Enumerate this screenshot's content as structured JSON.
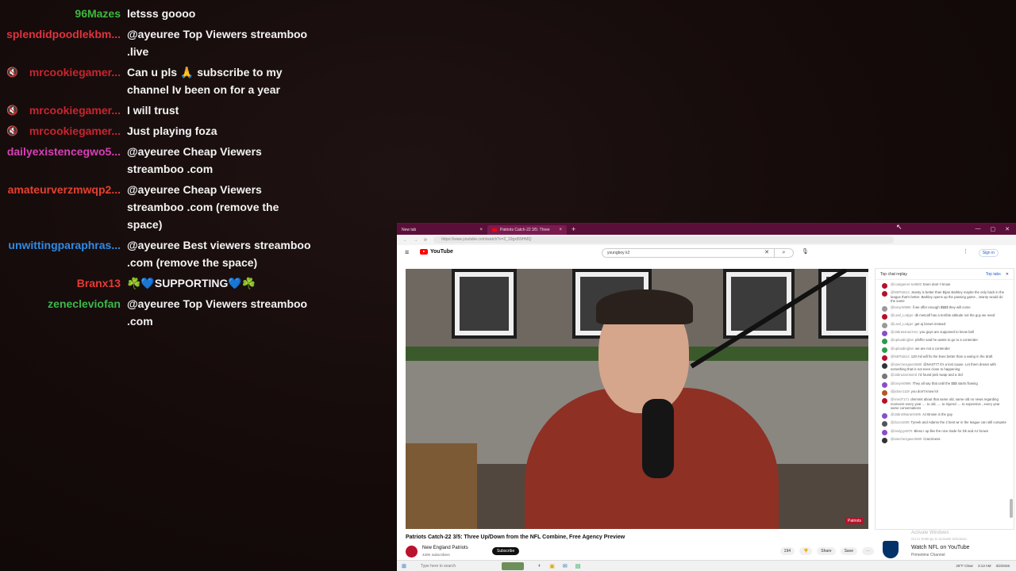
{
  "chat_overlay": [
    {
      "user": "96Mazes",
      "color": "#3db93d",
      "muted": false,
      "text": "letsss goooo"
    },
    {
      "user": "splendidpoodlekbm...",
      "color": "#e0333d",
      "muted": false,
      "text": "@ayeuree Top Viewers streamboo .live"
    },
    {
      "user": "mrcookiegamer...",
      "color": "#c8252f",
      "muted": true,
      "text": "Can u pls 🙏 subscribe to my channel Iv been on for a year"
    },
    {
      "user": "mrcookiegamer...",
      "color": "#c8252f",
      "muted": true,
      "text": "I will trust"
    },
    {
      "user": "mrcookiegamer...",
      "color": "#c8252f",
      "muted": true,
      "text": "Just playing foza"
    },
    {
      "user": "dailyexistencegwo5...",
      "color": "#d83fb6",
      "muted": false,
      "text": "@ayeuree Cheap Viewers streamboo .com"
    },
    {
      "user": "amateurverzmwqp2...",
      "color": "#e5402e",
      "muted": false,
      "text": "@ayeuree Cheap Viewers streamboo .com (remove the space)"
    },
    {
      "user": "unwittingparaphras...",
      "color": "#2f8be3",
      "muted": false,
      "text": "@ayeuree Best viewers streamboo .com (remove the space)"
    },
    {
      "user": "Branx13",
      "color": "#e53a36",
      "muted": false,
      "text": "☘️💙SUPPORTING💙☘️"
    },
    {
      "user": "zenecleviofan",
      "color": "#3cb84a",
      "muted": false,
      "text": "@ayeuree Top Viewers streamboo .com"
    }
  ],
  "mute_glyph": "🔇",
  "browser": {
    "tabs": [
      {
        "label": "New tab",
        "close": "×"
      },
      {
        "label": "Patriots Catch-22 3/5: Three",
        "close": "×"
      }
    ],
    "new_tab_glyph": "+",
    "window_controls": [
      "—",
      "▢",
      "✕"
    ],
    "url": "https://www.youtube.com/watch?v=2_19gxt59HMQ",
    "nav": {
      "back": "←",
      "forward": "→",
      "reload": "⟳"
    }
  },
  "youtube": {
    "logo_text": "YouTube",
    "menu_glyph": "≡",
    "search_value": "youngboy k2",
    "search_clear": "✕",
    "search_glyph": "⌕",
    "mic_glyph": "🎙",
    "more_glyph": "⋮",
    "signin_label": "Sign in",
    "video_title": "Patriots Catch-22 3/5: Three Up/Down from the NFL Combine, Free Agency Preview",
    "channel_name": "New England Patriots",
    "subscribers": "420K subscribers",
    "subscribe_label": "Subscribe",
    "likes": "194",
    "share_label": "Share",
    "save_label": "Save",
    "dislike_glyph": "👎",
    "overflow_glyph": "⋯",
    "watermark": "Patriots"
  },
  "live_chat": {
    "header": "Top chat replay",
    "top_selector": "Top tabs",
    "close_glyph": "✕",
    "messages": [
      {
        "author": "@coolgamer-tu9883",
        "text": "Even dont !! know",
        "color": "#b3122c"
      },
      {
        "author": "@NEPats14",
        "text": "Jeanty is better than Bijan Barkley maybe the only back in the league that's better. Barkley opens up the passing game , Jeanty would do the same",
        "color": "#b3122c"
      },
      {
        "author": "@tonym0996",
        "text": "if we offer enough $$$$ they will come",
        "color": "#999999"
      },
      {
        "author": "@Leaf_Lodger",
        "text": "dk metcalf has a terrible attitude not the guy we need",
        "color": "#b3122c"
      },
      {
        "author": "@Leaf_Lodger",
        "text": "get aj brown instead",
        "color": "#999999"
      },
      {
        "author": "@Jabrassnazzmo",
        "text": "you guys are supposed to know ball",
        "color": "#8a4fc7"
      },
      {
        "author": "@uploadingfan",
        "text": "pfeffer said he wants to go to a contender",
        "color": "#2e9b4b"
      },
      {
        "author": "@uploadingfan",
        "text": "we are not a contender",
        "color": "#2e9b4b"
      },
      {
        "author": "@NEPats14",
        "text": "120 mil will fix the lines better than a swing in the draft",
        "color": "#b3122c"
      },
      {
        "author": "@sanchezgave3680",
        "text": "@NA0777 it's a lost cause. Let them dream with something that is not even close to happening",
        "color": "#333333"
      },
      {
        "author": "@JabraJarrasmd",
        "text": "I'd found pick swap and a 3rd",
        "color": "#777777"
      },
      {
        "author": "@tonym0996",
        "text": "They all say that until the $$$ starts flowing",
        "color": "#8a4fc7"
      },
      {
        "author": "@jidour1118",
        "text": "you don't know lol",
        "color": "#b35a1f"
      },
      {
        "author": "@snnd7171",
        "text": "dmmmit about that same old, same old no news regarding receivers every year .... to old, .... to Injured .... to expensive , every year same conversations",
        "color": "#b3122c"
      },
      {
        "author": "@Jabro0baranh496",
        "text": "AJ Brown is the guy",
        "color": "#8a4fc7"
      },
      {
        "author": "@Zuzo1609",
        "text": "Tyreek and Adams the 2 best wr in the league can still compete",
        "color": "#555555"
      },
      {
        "author": "@realyyy4876",
        "text": "Bless I up like the nice trade for Dk and AJ brown",
        "color": "#8a4fc7"
      },
      {
        "author": "@sanchezgave3680",
        "text": "Crazziness",
        "color": "#333333"
      }
    ],
    "activate_title": "Activate Windows",
    "activate_sub": "Go to Settings to activate Windows.",
    "promo_title": "Watch NFL on YouTube",
    "promo_sub": "Primetime Channel"
  },
  "taskbar": {
    "start_glyph": "⊞",
    "search_placeholder": "Type here to search",
    "weather": "29°F Clear",
    "time": "3:13 AM",
    "date": "3/2/2026",
    "app_glyphs": [
      "◐",
      "▣",
      "✉",
      "▤"
    ]
  }
}
